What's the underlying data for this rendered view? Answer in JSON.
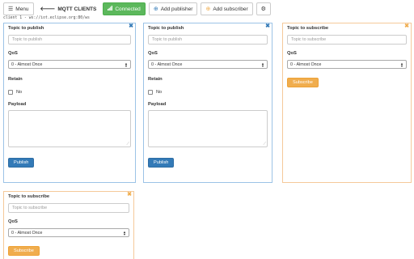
{
  "toolbar": {
    "menu_label": "Menu",
    "back_label": "MQTT CLIENTS",
    "connected_label": "Connected",
    "add_publisher_label": "Add publisher",
    "add_subscriber_label": "Add subscriber"
  },
  "client_info": "client 1 - ws://iot.eclipse.org:80/ws",
  "colors": {
    "publisher_accent": "#337ab7",
    "subscriber_accent": "#f0ad4e",
    "connected": "#5cb85c"
  },
  "publishers": [
    {
      "topic_label": "Topic to publish",
      "topic_placeholder": "Topic to publish",
      "qos_label": "QoS",
      "qos_value": "0 - Almost Once",
      "retain_label": "Retain",
      "retain_option": "No",
      "payload_label": "Payload",
      "button_label": "Publish"
    },
    {
      "topic_label": "Topic to publish",
      "topic_placeholder": "Topic to publish",
      "qos_label": "QoS",
      "qos_value": "0 - Almost Once",
      "retain_label": "Retain",
      "retain_option": "No",
      "payload_label": "Payload",
      "button_label": "Publish"
    }
  ],
  "subscribers": [
    {
      "topic_label": "Topic to subscribe",
      "topic_placeholder": "Topic to subscribe",
      "qos_label": "QoS",
      "qos_value": "0 - Almost Once",
      "button_label": "Subscribe"
    },
    {
      "topic_label": "Topic to subscribe",
      "topic_placeholder": "Topic to subscribe",
      "qos_label": "QoS",
      "qos_value": "0 - Almost Once",
      "button_label": "Subscribe"
    }
  ],
  "icons": {
    "menu": "hamburger-icon",
    "back": "arrow-left-icon",
    "connected": "signal-icon",
    "add_publisher": "plus-circle-icon",
    "add_subscriber": "plus-circle-icon",
    "settings": "gear-icon",
    "close": "close-icon"
  }
}
